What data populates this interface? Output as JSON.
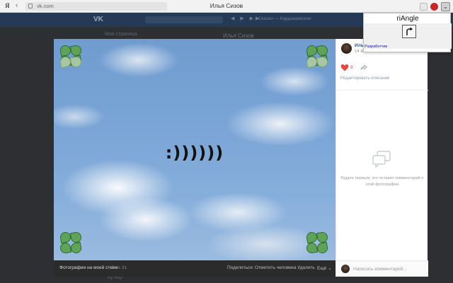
{
  "browser": {
    "logo": "Я",
    "back_glyph": "‹",
    "url": "vk.com",
    "title": "Илья Сизов",
    "menu_glyph": "⌄"
  },
  "vk_background": {
    "sidebar_label": "Моя страница",
    "profile_name": "Илья Сизов",
    "music_title": "Сказки — Кардашевская",
    "sidebar_bottom": "ну нор"
  },
  "photo": {
    "caption": ":))))))"
  },
  "footer": {
    "album": "Фотографии на моей стене",
    "count": "2 из 31",
    "share": "Поделиться",
    "tag_person": "Отметить человека",
    "delete": "Удалить",
    "more": "Ещё ⌄"
  },
  "side_panel": {
    "owner_name": "Илья",
    "owner_date": "14 ян",
    "like_count": "8",
    "edit_description": "Редактировать описание",
    "empty_comments": "Будьте первым, кто оставит комментарий к этой фотографии",
    "comment_placeholder": "Написать комментарий..."
  },
  "ext_popup": {
    "title": "riAngle",
    "link": "Разработчик"
  },
  "colors": {
    "vk_header": "#253a55",
    "link_blue": "#2a5885",
    "like_red": "#e64646"
  }
}
